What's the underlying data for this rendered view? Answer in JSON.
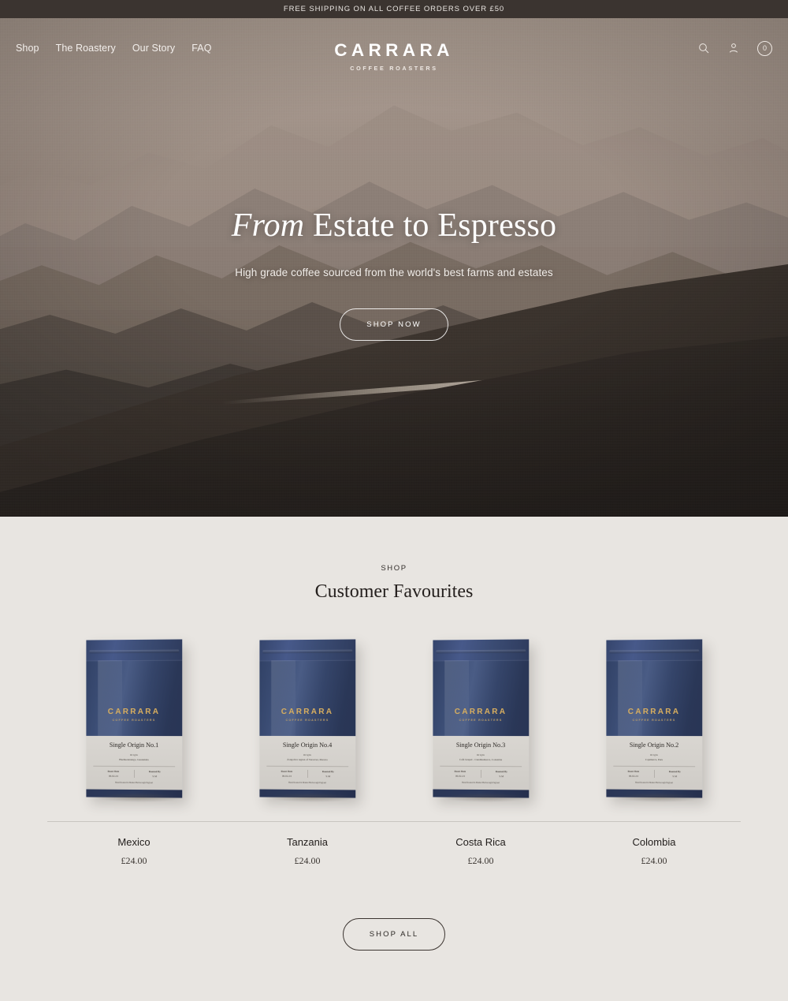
{
  "announcement": {
    "text": "FREE SHIPPING ON ALL COFFEE ORDERS OVER £50"
  },
  "nav": {
    "links": [
      {
        "label": "Shop"
      },
      {
        "label": "The Roastery"
      },
      {
        "label": "Our Story"
      },
      {
        "label": "FAQ"
      }
    ],
    "brand": {
      "name": "CARRARA",
      "sub": "COFFEE ROASTERS"
    },
    "icons": {
      "search": "search-icon",
      "account": "account-icon"
    },
    "cart_count": "0"
  },
  "hero": {
    "title_italic": "From",
    "title_rest": " Estate to Espresso",
    "subtitle": "High grade coffee sourced from the world's best farms and estates",
    "cta": "SHOP NOW"
  },
  "shop": {
    "eyebrow": "SHOP",
    "title": "Customer Favourites",
    "shop_all": "SHOP ALL",
    "bag_logo": {
      "name": "CARRARA",
      "sub": "COFFEE ROASTERS"
    },
    "label_headers": {
      "origin": "Origin",
      "roast_date": "Roast Date",
      "roasted_by": "Roasted By",
      "footer": "Hand Roasted in Market Harborough England"
    },
    "products": [
      {
        "name": "Mexico",
        "price": "£24.00",
        "bag_title": "Single Origin No.1",
        "origin": "Huehuetenango, Guatemala",
        "roast_date": "06.02.24",
        "roasted_by": "S.M"
      },
      {
        "name": "Tanzania",
        "price": "£24.00",
        "bag_title": "Single Origin No.4",
        "origin": "Zongolica region of Veracruz, Mexico",
        "roast_date": "06.02.24",
        "roasted_by": "S.M"
      },
      {
        "name": "Costa Rica",
        "price": "£24.00",
        "bag_title": "Single Origin No.3",
        "origin": "Café Grupel - Cundinamarca, Colombia",
        "roast_date": "06.02.24",
        "roasted_by": "S.M"
      },
      {
        "name": "Colombia",
        "price": "£24.00",
        "bag_title": "Single Origin No.2",
        "origin": "Cajamarca, Peru",
        "roast_date": "06.02.24",
        "roasted_by": "S.M"
      }
    ]
  },
  "colors": {
    "announce_bg": "#3b3430",
    "section_bg": "#e8e5e1",
    "bag_navy": "#35456c",
    "bag_gold": "#d8ae5f",
    "text_dark": "#24201e"
  }
}
